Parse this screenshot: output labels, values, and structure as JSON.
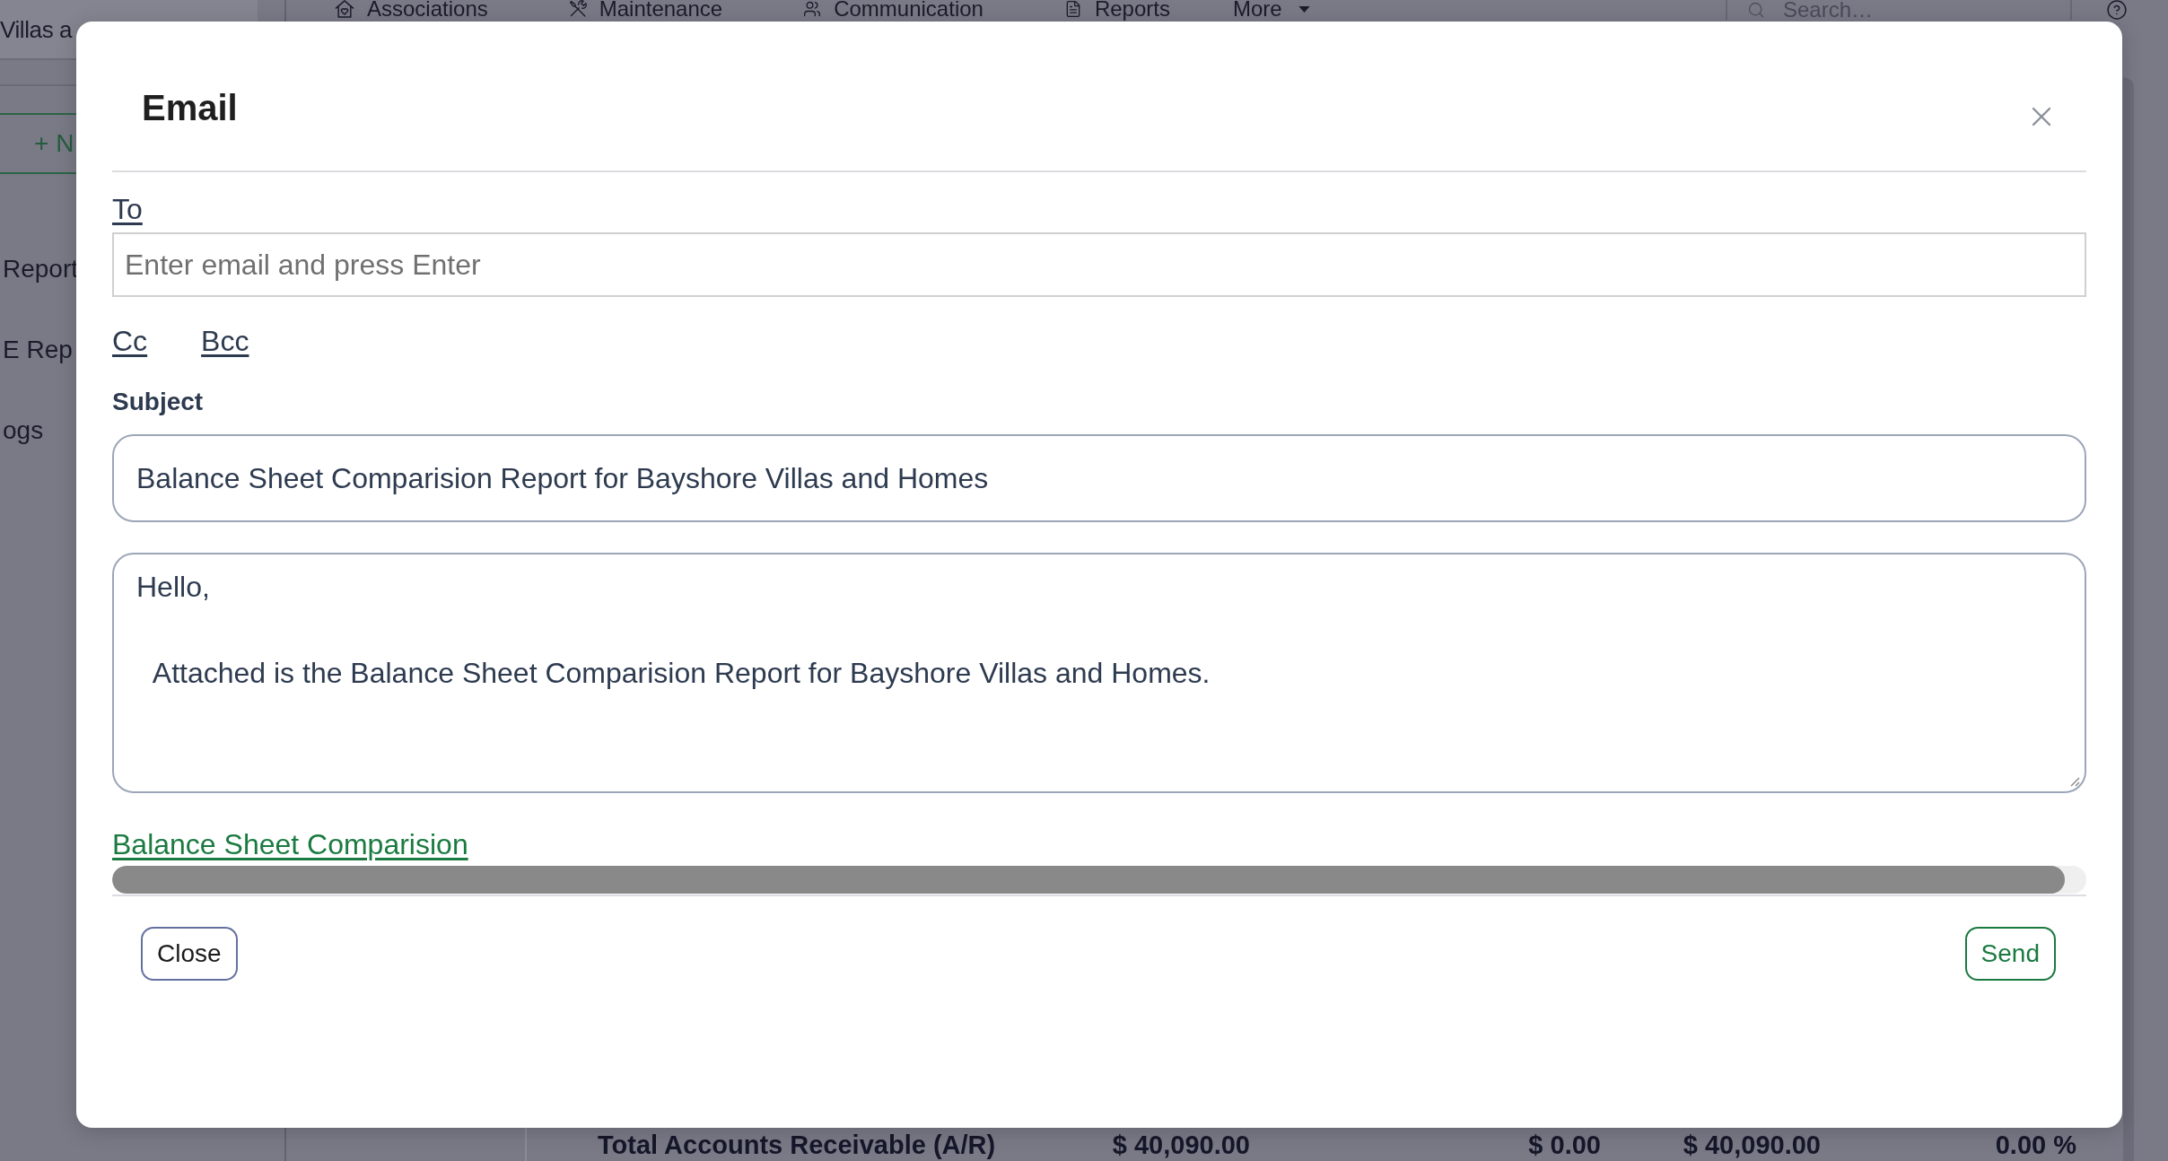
{
  "sidebar": {
    "title": "Villas a",
    "new_button": "+ N",
    "items": [
      {
        "label": "Report"
      },
      {
        "label": "E Rep"
      },
      {
        "label": "ogs"
      }
    ]
  },
  "top_nav": {
    "items": [
      {
        "label": "Associations",
        "kind": "link"
      },
      {
        "label": "Maintenance",
        "kind": "link"
      },
      {
        "label": "Communication",
        "kind": "link"
      },
      {
        "label": "Reports",
        "kind": "link"
      },
      {
        "label": "More",
        "kind": "dropdown"
      }
    ],
    "search": {
      "placeholder": "Search…"
    }
  },
  "report": {
    "totals_row": [
      "Total Accounts Receivable (A/R)",
      "$ 40,090.00",
      "$ 0.00",
      "$ 40,090.00",
      "0.00 %"
    ]
  },
  "email_dialog": {
    "title": "Email",
    "to": {
      "label": "To",
      "placeholder": "Enter email and press Enter"
    },
    "copy_links": [
      "Cc",
      "Bcc"
    ],
    "subject": {
      "label": "Subject",
      "value": "Balance Sheet Comparision Report for Bayshore Villas and Homes"
    },
    "message": {
      "value": "Hello,\n\n  Attached is the Balance Sheet Comparision Report for Bayshore Villas and Homes."
    },
    "attachment": {
      "name": "Balance Sheet Comparision",
      "level": 0.989
    },
    "buttons": [
      {
        "label": "Close",
        "kind": "secondary"
      },
      {
        "label": "Send",
        "kind": "primary"
      }
    ]
  }
}
